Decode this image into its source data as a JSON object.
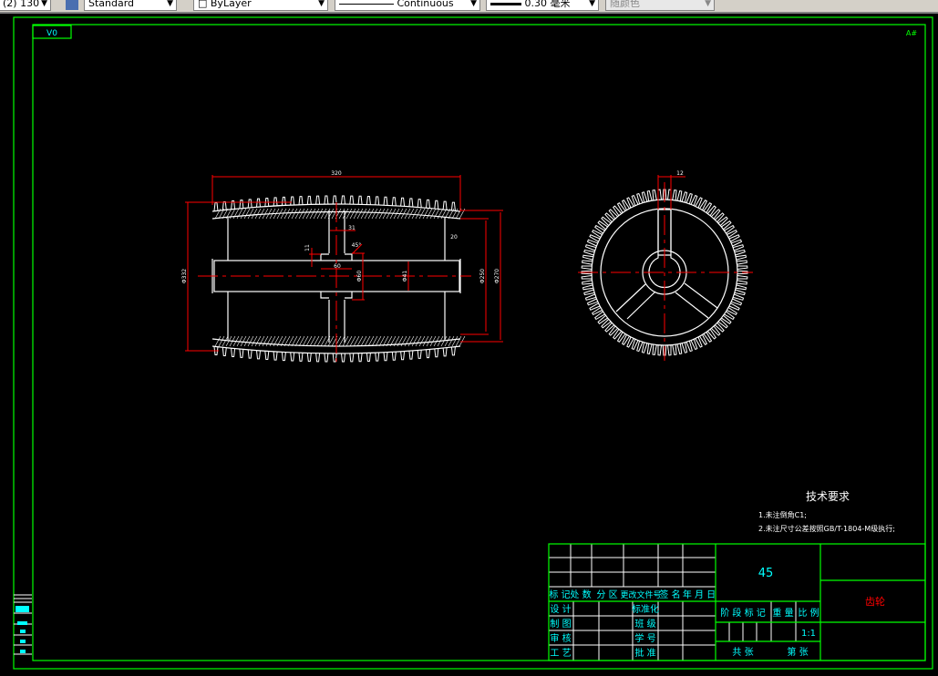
{
  "toolbar": {
    "scale_value": "(2) 130",
    "text_style": "Standard",
    "layer_color": "ByLayer",
    "linetype": "Continuous",
    "lineweight": "0.30 毫米",
    "plot_style": "随颜色"
  },
  "drawing": {
    "frame_code": "V0",
    "corner_mark": "A#",
    "dims_front": {
      "width": "320",
      "left_dia": "Φ332",
      "hub_width": "31",
      "rim": "20",
      "chamfer": "45°",
      "key_w": "11",
      "bore_len": "60",
      "hub_dia": "Φ60",
      "bore_dia": "Φ41",
      "dia_250": "Φ250",
      "dia_270": "Φ270"
    },
    "dims_side": {
      "key": "12"
    },
    "tech_req": {
      "title": "技术要求",
      "items": [
        "1.未注倒角C1;",
        "2.未注尺寸公差按照GB/T-1804-M级执行;"
      ]
    },
    "title_block": {
      "material": "45",
      "part_name": "齿轮",
      "scale": "1:1",
      "header_row": [
        "标 记",
        "处 数",
        "分 区",
        "更改文件号",
        "签 名",
        "年 月 日"
      ],
      "sign_rows": [
        {
          "left": "设 计",
          "right": "标准化"
        },
        {
          "left": "制 图",
          "right": "班 级"
        },
        {
          "left": "审 核",
          "right": "学 号"
        },
        {
          "left": "工 艺",
          "right": "批 准"
        }
      ],
      "stage_header": [
        "阶 段 标 记",
        "重 量",
        "比 例"
      ],
      "sheet_total": "共    张",
      "sheet_no": "第    张"
    },
    "colors": {
      "frame": "#00ff00",
      "dim": "#ff0000",
      "text": "#00ffff",
      "line": "#ffffff",
      "name": "#ff0000"
    }
  }
}
